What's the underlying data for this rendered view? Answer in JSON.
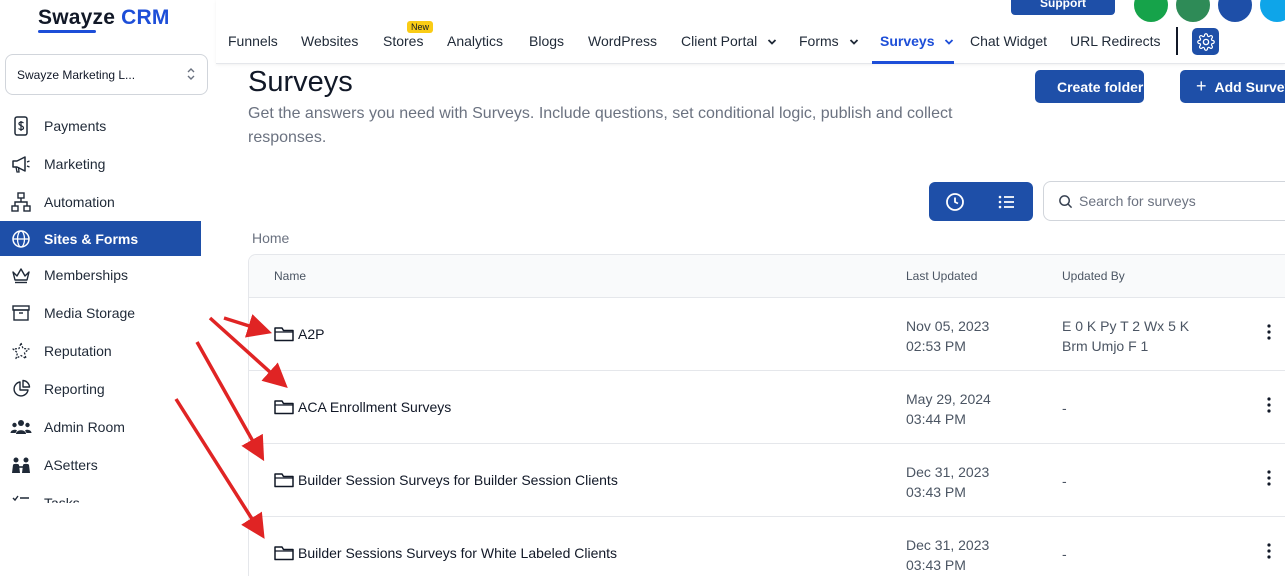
{
  "app": {
    "logo_main": "Swayze",
    "logo_accent": "CRM",
    "account_name": "Swayze Marketing L..."
  },
  "sidebar": {
    "items": [
      {
        "label": "Payments",
        "icon": "payments-icon"
      },
      {
        "label": "Marketing",
        "icon": "megaphone-icon"
      },
      {
        "label": "Automation",
        "icon": "automation-icon"
      },
      {
        "label": "Sites & Forms",
        "icon": "globe-icon",
        "active": true
      },
      {
        "label": "Memberships",
        "icon": "crown-icon"
      },
      {
        "label": "Media Storage",
        "icon": "archive-icon"
      },
      {
        "label": "Reputation",
        "icon": "reputation-icon"
      },
      {
        "label": "Reporting",
        "icon": "pie-chart-icon"
      },
      {
        "label": "Admin Room",
        "icon": "team-icon"
      },
      {
        "label": "ASetters",
        "icon": "setters-icon"
      },
      {
        "label": "Tasks",
        "icon": "tasks-icon"
      }
    ]
  },
  "topnav": {
    "tabs": [
      {
        "label": "Funnels"
      },
      {
        "label": "Websites"
      },
      {
        "label": "Stores",
        "badge": "New"
      },
      {
        "label": "Analytics"
      },
      {
        "label": "Blogs"
      },
      {
        "label": "WordPress"
      },
      {
        "label": "Client Portal",
        "dropdown": true
      },
      {
        "label": "Forms",
        "dropdown": true
      },
      {
        "label": "Surveys",
        "dropdown": true,
        "active": true
      },
      {
        "label": "Chat Widget"
      },
      {
        "label": "URL Redirects"
      }
    ],
    "support_label": "Support"
  },
  "page": {
    "title": "Surveys",
    "description": "Get the answers you need with Surveys. Include questions, set conditional logic, publish and collect responses.",
    "create_folder_label": "Create folder",
    "add_survey_label": "Add Survey",
    "search_placeholder": "Search for surveys",
    "breadcrumb": "Home"
  },
  "table": {
    "columns": [
      "Name",
      "Last Updated",
      "Updated By"
    ],
    "rows": [
      {
        "name": "A2P",
        "date": "Nov 05, 2023",
        "time": "02:53 PM",
        "by_line1": "E 0 K Py T 2 Wx 5 K",
        "by_line2": "Brm Umjo F 1"
      },
      {
        "name": "ACA Enrollment Surveys",
        "date": "May 29, 2024",
        "time": "03:44 PM",
        "by_line1": "-",
        "by_line2": ""
      },
      {
        "name": "Builder Session Surveys for Builder Session Clients",
        "date": "Dec 31, 2023",
        "time": "03:43 PM",
        "by_line1": "-",
        "by_line2": ""
      },
      {
        "name": "Builder Sessions Surveys for White Labeled Clients",
        "date": "Dec 31, 2023",
        "time": "03:43 PM",
        "by_line1": "-",
        "by_line2": ""
      }
    ]
  },
  "colors": {
    "primary": "#1e4fa8",
    "annotation_arrow": "#e02424",
    "phone_green": "#16a34a",
    "brand_green": "#2e8b57",
    "accent_cyan": "#0ea5e9"
  }
}
